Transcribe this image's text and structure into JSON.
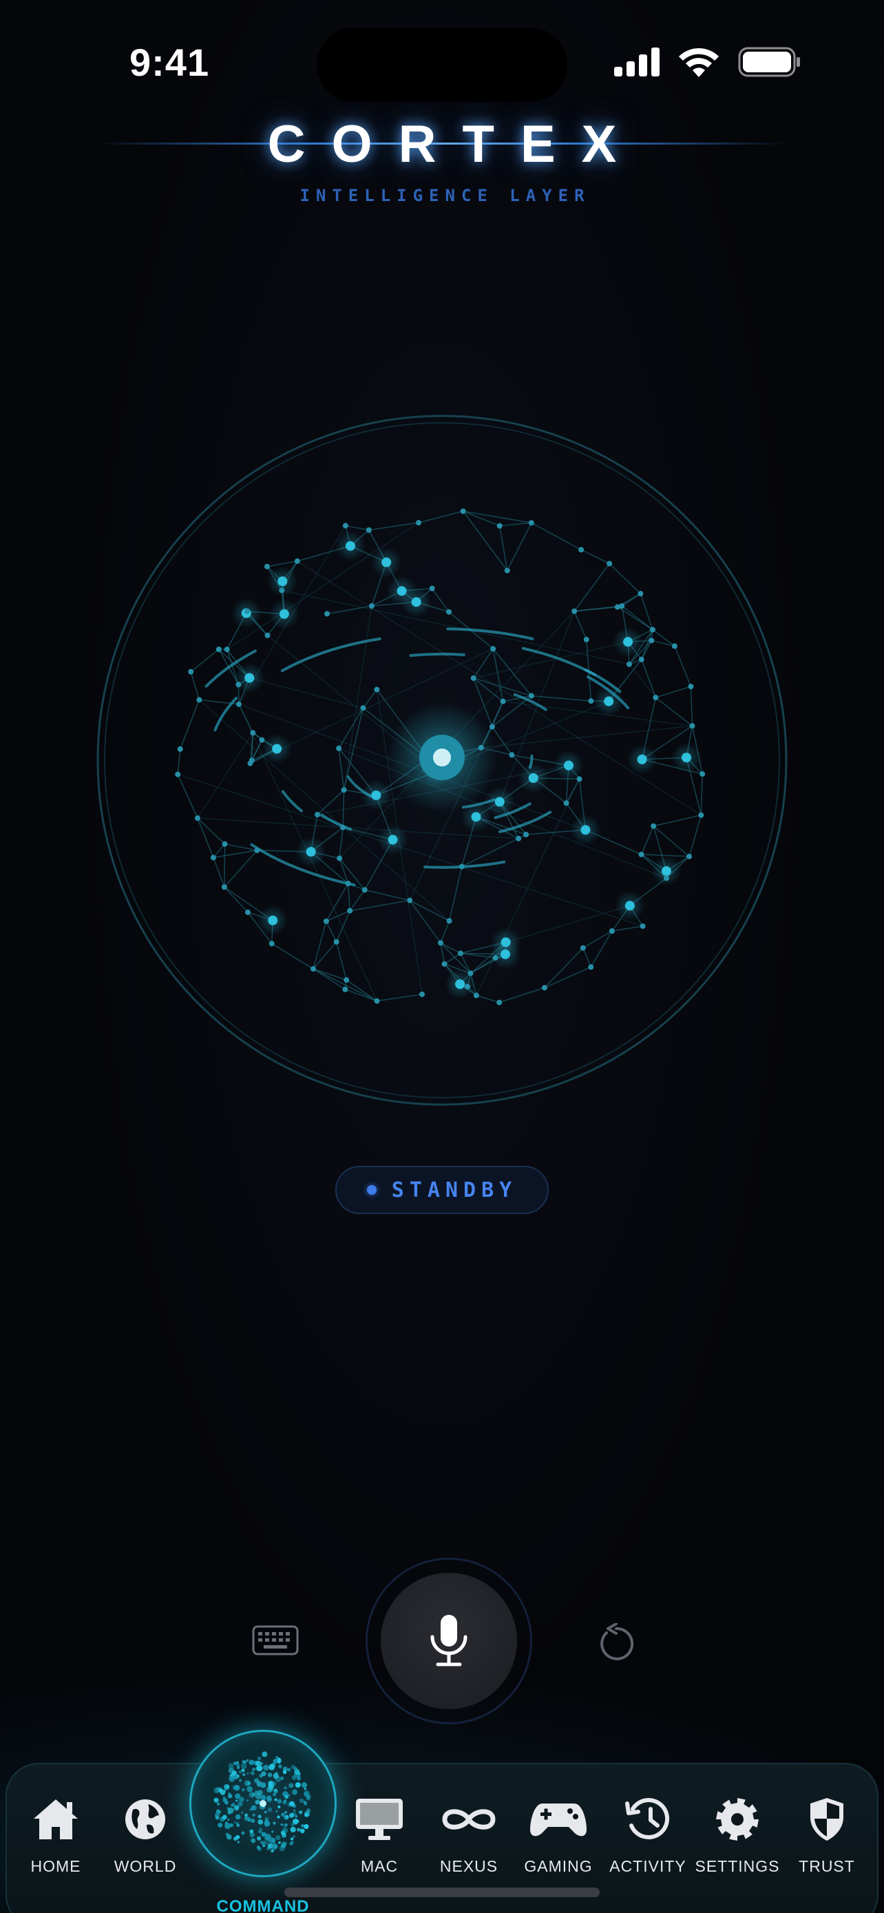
{
  "status_bar": {
    "time": "9:41",
    "icons": [
      "signal-icon",
      "wifi-icon",
      "battery-icon"
    ]
  },
  "header": {
    "title": "CORTEX",
    "subtitle": "INTELLIGENCE LAYER"
  },
  "status": {
    "label": "STANDBY",
    "color": "#4684f0"
  },
  "controls": {
    "keyboard": "keyboard-icon",
    "mic": "microphone-icon",
    "reset": "rotate-ccw-icon"
  },
  "tabs": [
    {
      "label": "HOME",
      "icon": "house-icon"
    },
    {
      "label": "WORLD",
      "icon": "globe-icon"
    },
    {
      "label": "COMMAND",
      "icon": "neural-orb-icon",
      "active": true
    },
    {
      "label": "MAC",
      "icon": "desktop-icon"
    },
    {
      "label": "NEXUS",
      "icon": "infinity-icon"
    },
    {
      "label": "GAMING",
      "icon": "gamepad-icon"
    },
    {
      "label": "ACTIVITY",
      "icon": "history-icon"
    },
    {
      "label": "SETTINGS",
      "icon": "gear-icon"
    },
    {
      "label": "TRUST",
      "icon": "shield-icon"
    }
  ],
  "colors": {
    "accent": "#17c3e0",
    "background": "#05060a",
    "network": "#2aa9c4"
  }
}
